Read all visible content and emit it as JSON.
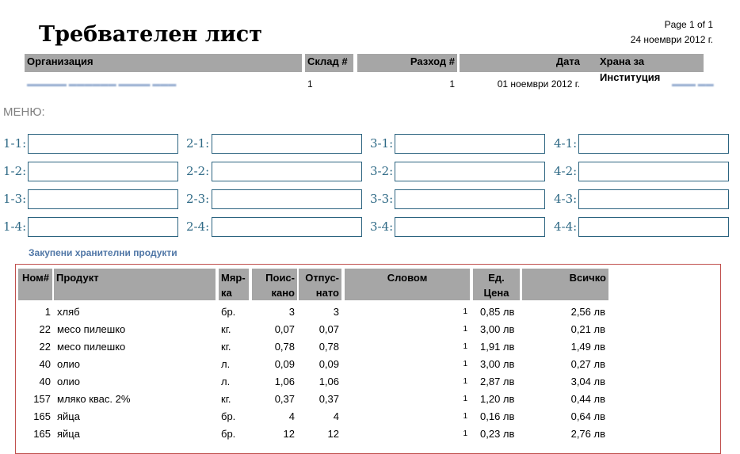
{
  "title": "Требвателен лист",
  "page_info": {
    "page": "Page 1 of 1",
    "date": "24 ноември 2012 г."
  },
  "header_columns": {
    "organization": "Организация",
    "warehouse": "Склад #",
    "expense": "Разход #",
    "date": "Дата",
    "food": "Храна за Институция"
  },
  "header_values": {
    "warehouse": "1",
    "expense": "1",
    "date": "01 ноември 2012 г."
  },
  "menu": {
    "label": "МЕНЮ:",
    "fields": [
      [
        "1-1:",
        "2-1:",
        "3-1:",
        "4-1:"
      ],
      [
        "1-2:",
        "2-2:",
        "3-2:",
        "4-2:"
      ],
      [
        "1-3:",
        "2-3:",
        "3-3:",
        "4-3:"
      ],
      [
        "1-4:",
        "2-4:",
        "3-4:",
        "4-4:"
      ]
    ]
  },
  "products": {
    "section_title": "Закупени хранителни продукти",
    "columns": {
      "num": "Ном#",
      "product": "Продукт",
      "unit": "Мяр-ка",
      "requested": "Поис-кано",
      "released": "Отпус-нато",
      "words": "Словом",
      "unit_price": "Ед. Цена",
      "total": "Всичко"
    },
    "rows": [
      {
        "num": "1",
        "product": "хляб",
        "unit": "бр.",
        "requested": "3",
        "released": "3",
        "words": "1",
        "unit_price": "0,85 лв",
        "total": "2,56 лв"
      },
      {
        "num": "22",
        "product": "месо пилешко",
        "unit": "кг.",
        "requested": "0,07",
        "released": "0,07",
        "words": "1",
        "unit_price": "3,00 лв",
        "total": "0,21 лв"
      },
      {
        "num": "22",
        "product": "месо пилешко",
        "unit": "кг.",
        "requested": "0,78",
        "released": "0,78",
        "words": "1",
        "unit_price": "1,91 лв",
        "total": "1,49 лв"
      },
      {
        "num": "40",
        "product": "олио",
        "unit": "л.",
        "requested": "0,09",
        "released": "0,09",
        "words": "1",
        "unit_price": "3,00 лв",
        "total": "0,27 лв"
      },
      {
        "num": "40",
        "product": "олио",
        "unit": "л.",
        "requested": "1,06",
        "released": "1,06",
        "words": "1",
        "unit_price": "2,87 лв",
        "total": "3,04 лв"
      },
      {
        "num": "157",
        "product": "мляко квас. 2%",
        "unit": "кг.",
        "requested": "0,37",
        "released": "0,37",
        "words": "1",
        "unit_price": "1,20 лв",
        "total": "0,44 лв"
      },
      {
        "num": "165",
        "product": "яйца",
        "unit": "бр.",
        "requested": "4",
        "released": "4",
        "words": "1",
        "unit_price": "0,16 лв",
        "total": "0,64 лв"
      },
      {
        "num": "165",
        "product": "яйца",
        "unit": "бр.",
        "requested": "12",
        "released": "12",
        "words": "1",
        "unit_price": "0,23 лв",
        "total": "2,76 лв"
      }
    ]
  }
}
